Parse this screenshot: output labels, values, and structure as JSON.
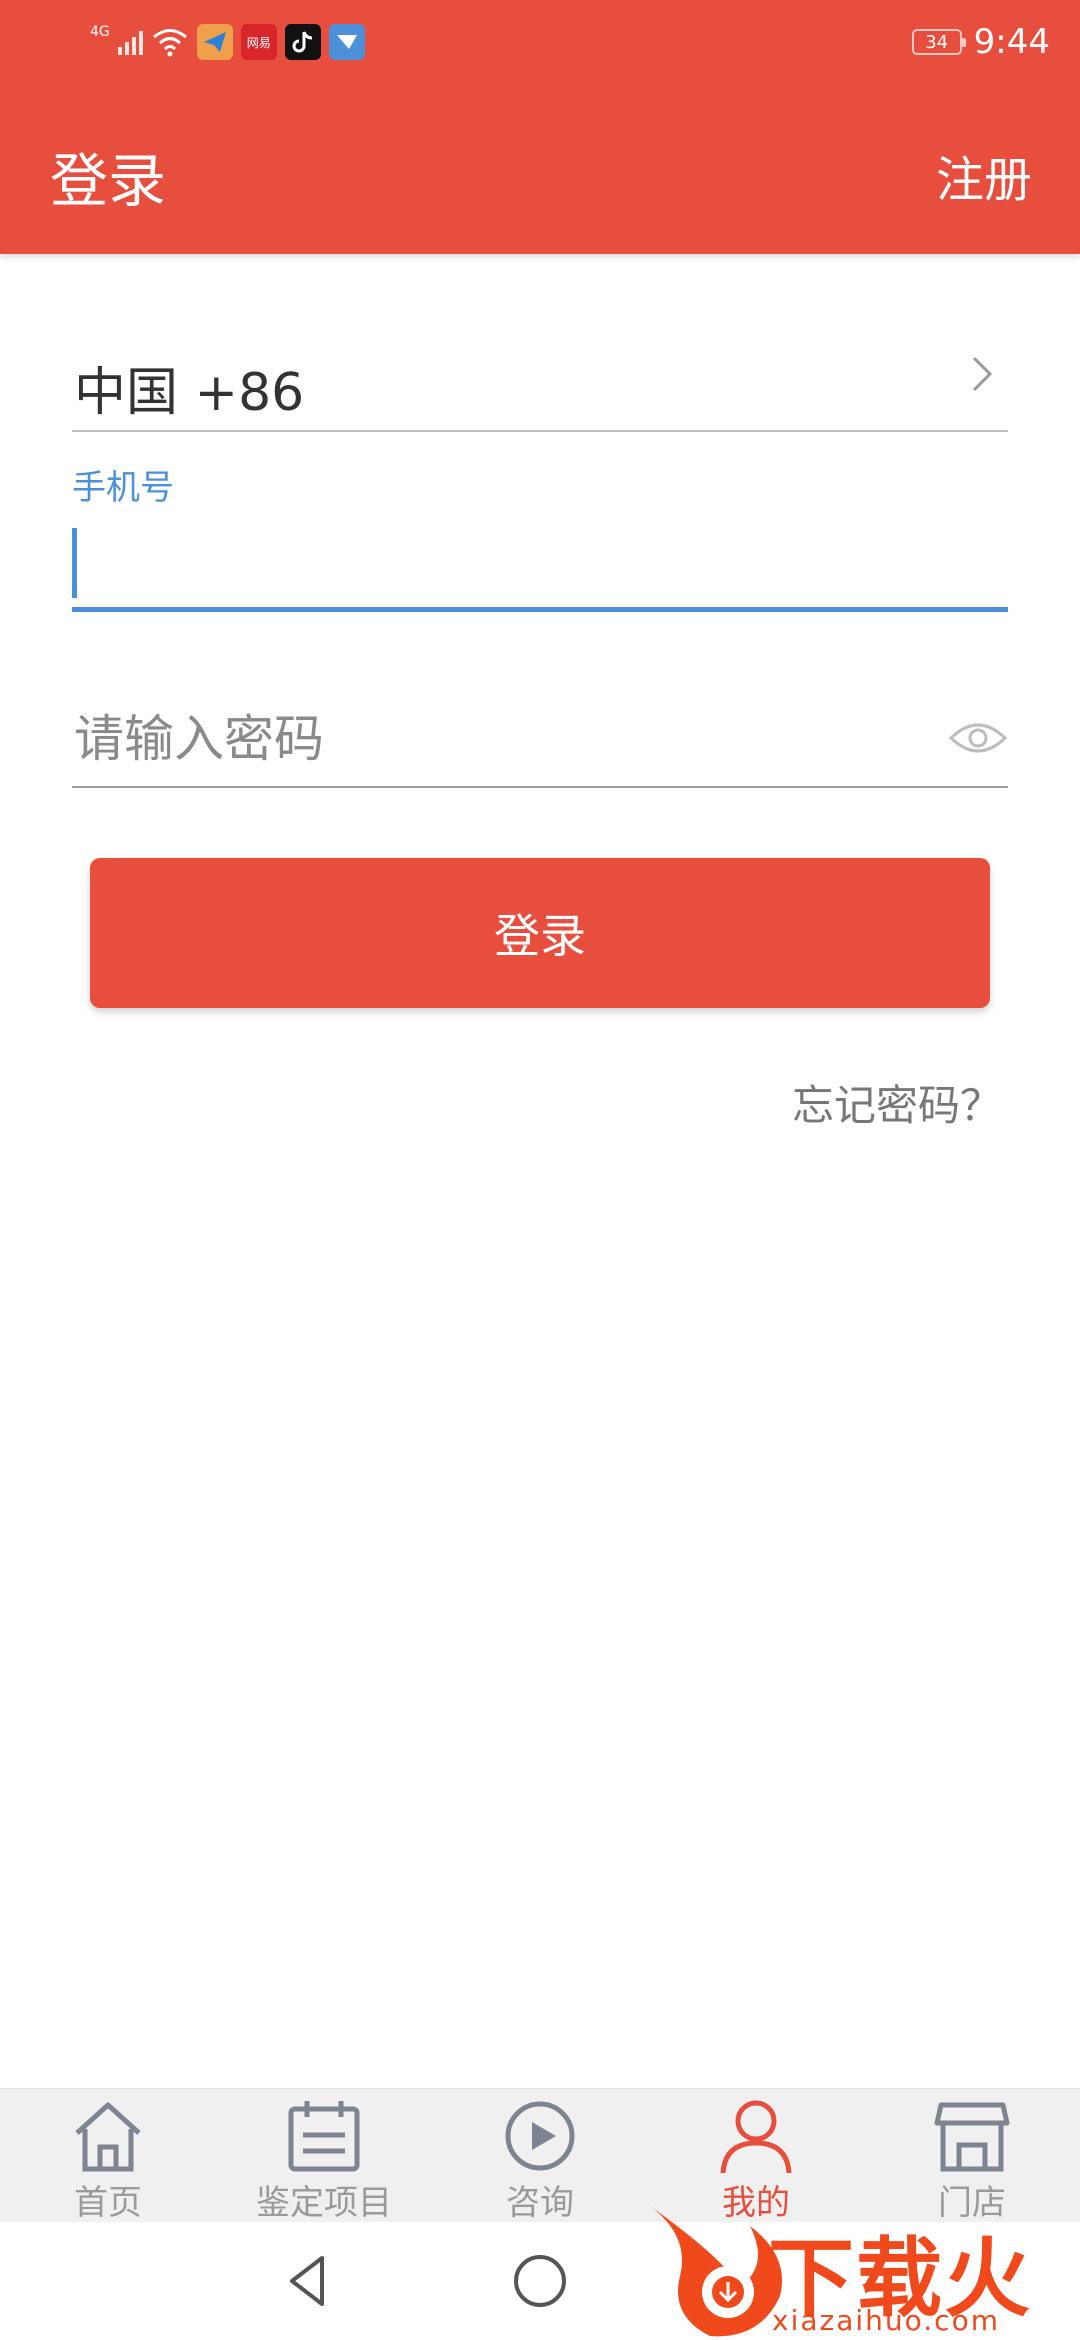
{
  "status_bar": {
    "network": "4G",
    "battery": "34",
    "time": "9:44",
    "notification_icons": [
      "telegram-icon",
      "wangyi-news-icon",
      "tiktok-icon",
      "mail-icon"
    ],
    "wangyi_label": "网易"
  },
  "header": {
    "title": "登录",
    "register_label": "注册"
  },
  "form": {
    "country_code": "中国 +86",
    "phone_label": "手机号",
    "phone_value": "",
    "password_placeholder": "请输入密码",
    "login_button": "登录",
    "forgot_password": "忘记密码？"
  },
  "tabbar": {
    "tabs": [
      {
        "label": "首页",
        "icon": "home-icon",
        "active": false
      },
      {
        "label": "鉴定项目",
        "icon": "calendar-icon",
        "active": false
      },
      {
        "label": "咨询",
        "icon": "play-icon",
        "active": false
      },
      {
        "label": "我的",
        "icon": "user-icon",
        "active": true
      },
      {
        "label": "门店",
        "icon": "store-icon",
        "active": false
      }
    ]
  },
  "watermark": {
    "brand": "下载火",
    "url": "xiazaihuo.com"
  },
  "colors": {
    "primary": "#e84e3d",
    "focus": "#4a90d9",
    "tab_inactive": "#9a9a9a"
  }
}
